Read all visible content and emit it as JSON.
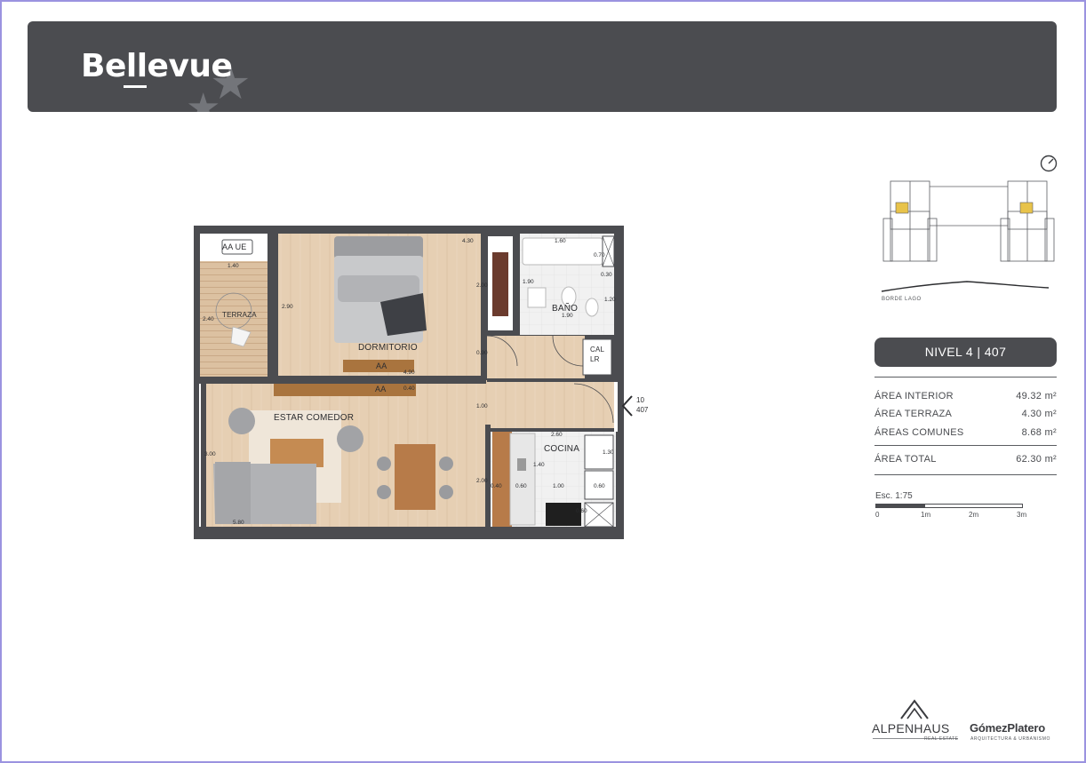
{
  "header": {
    "logo_text": "Bellevue"
  },
  "floorplan": {
    "rooms": {
      "terrace": "TERRAZA",
      "bedroom": "DORMITORIO",
      "bathroom": "BAÑO",
      "living": "ESTAR COMEDOR",
      "kitchen": "COCINA"
    },
    "fixtures": {
      "ac_outdoor": "AA UE",
      "ac_bedroom": "AA",
      "ac_living": "AA",
      "heater": "CAL\nLR"
    },
    "dimensions": {
      "terrace_w": "1.40",
      "terrace_h": "2.40",
      "bed_top": "4.30",
      "bed_side": "2.90",
      "closet_h": "2.00",
      "bedroom_w": "4.90",
      "bedroom_door": "0.90",
      "bath_w": "1.60",
      "bath_a": "0.70",
      "bath_b": "0.30",
      "bath_c": "1.90",
      "bath_d": "1.20",
      "bath_e": "1.90",
      "living_ac": "0.40",
      "living_door": "1.00",
      "living_h": "3.00",
      "living_w": "5.80",
      "kitchen_w": "2.60",
      "kitchen_a": "1.40",
      "kitchen_b": "1.30",
      "kitchen_c": "2.00",
      "kitchen_d": "0.40",
      "kitchen_e": "0.60",
      "kitchen_f": "1.00",
      "kitchen_g": "0.60",
      "kitchen_h": "0.60"
    },
    "entry_marker": {
      "line1": "10",
      "line2": "407"
    }
  },
  "keyplan": {
    "label": "BORDE LAGO"
  },
  "unit": {
    "title": "NIVEL 4 | 407"
  },
  "areas": [
    {
      "label": "ÁREA INTERIOR",
      "value": "49.32 m²"
    },
    {
      "label": "ÁREA TERRAZA",
      "value": "4.30 m²"
    },
    {
      "label": "ÁREAS COMUNES",
      "value": "8.68 m²"
    }
  ],
  "total_area": {
    "label": "ÁREA TOTAL",
    "value": "62.30 m²"
  },
  "scale": {
    "title": "Esc. 1:75",
    "ticks": [
      "0",
      "1m",
      "2m",
      "3m"
    ]
  },
  "brands": {
    "alpenhaus": "ALPENHAUS",
    "alpenhaus_sub": "REAL ESTATE",
    "gomez": "GómezPlatero",
    "gomez_sub": "ARQUITECTURA & URBANISMO"
  },
  "colors": {
    "header_bg": "#4b4c50",
    "floor_wood": "#e4cdb1",
    "wall": "#4b4c50",
    "highlight_unit": "#e8c34a"
  }
}
